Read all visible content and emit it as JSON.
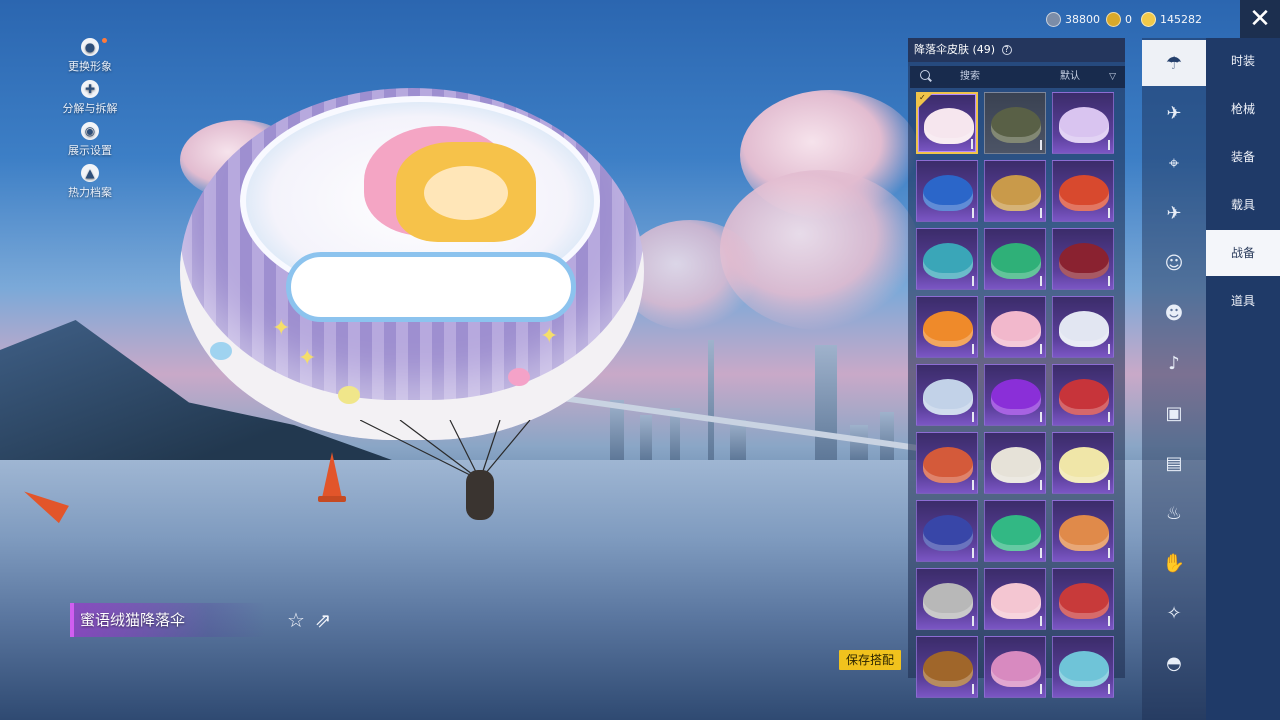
{
  "currency": {
    "silver": "38800",
    "gold": "0",
    "coupons": "145282"
  },
  "left_menu": [
    {
      "label": "更换形象",
      "icon": "avatar-icon"
    },
    {
      "label": "分解与拆解",
      "icon": "puzzle-icon"
    },
    {
      "label": "展示设置",
      "icon": "eye-icon"
    },
    {
      "label": "热力档案",
      "icon": "flame-icon"
    }
  ],
  "item": {
    "name": "蜜语绒猫降落伞"
  },
  "save_button": "保存搭配",
  "panel": {
    "title": "降落伞皮肤 (49)",
    "search_placeholder": "搜索",
    "sort_value": "默认"
  },
  "skins": [
    {
      "color": "#f6e6ee",
      "selected": true
    },
    {
      "color": "#596046"
    },
    {
      "color": "#d9c4f0"
    },
    {
      "color": "#2b66c9"
    },
    {
      "color": "#c99a4a"
    },
    {
      "color": "#d8492e"
    },
    {
      "color": "#3aa6b8"
    },
    {
      "color": "#2fb078"
    },
    {
      "color": "#8a2230"
    },
    {
      "color": "#ef8a2a"
    },
    {
      "color": "#f2b8cc"
    },
    {
      "color": "#e2e6f2"
    },
    {
      "color": "#c2d2e8"
    },
    {
      "color": "#8a2fd8"
    },
    {
      "color": "#c7343a"
    },
    {
      "color": "#d45a3a"
    },
    {
      "color": "#e6e2d8"
    },
    {
      "color": "#f0e6a8"
    },
    {
      "color": "#3846a8"
    },
    {
      "color": "#32b884"
    },
    {
      "color": "#e08a4a"
    },
    {
      "color": "#b8b8b8"
    },
    {
      "color": "#f4c6d2"
    },
    {
      "color": "#c83a3a"
    },
    {
      "color": "#a0662a"
    },
    {
      "color": "#d88ac0"
    },
    {
      "color": "#6fc4d8"
    }
  ],
  "category_icons": [
    "parachute-icon",
    "glider-icon",
    "drone-icon",
    "plane-icon",
    "emote-icon",
    "companion-icon",
    "voice-icon",
    "badge-icon",
    "photo-icon",
    "fire-extinguisher-icon",
    "hand-gesture-icon",
    "sparkle-wand-icon",
    "landing-effect-icon"
  ],
  "tabs": [
    {
      "label": "时装",
      "active": false
    },
    {
      "label": "枪械",
      "active": false
    },
    {
      "label": "装备",
      "active": false
    },
    {
      "label": "载具",
      "active": false
    },
    {
      "label": "战备",
      "active": true
    },
    {
      "label": "道具",
      "active": false
    }
  ]
}
